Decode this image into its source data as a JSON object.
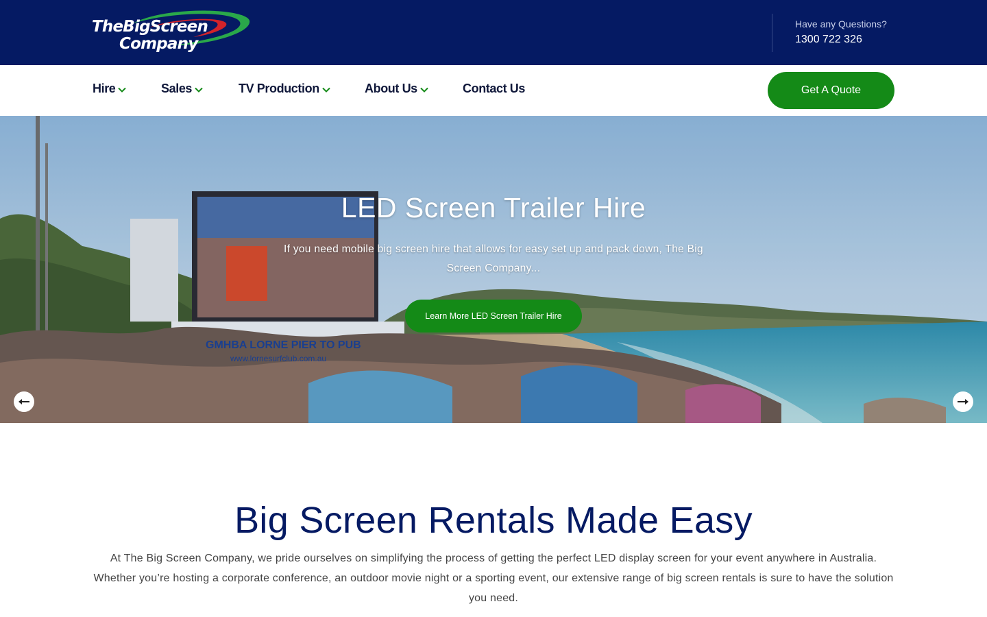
{
  "header": {
    "logo_line1": "TheBigScreen",
    "logo_line2": "Company",
    "questions_label": "Have any Questions?",
    "phone": "1300 722 326"
  },
  "nav": {
    "items": [
      {
        "label": "Hire",
        "has_dropdown": true
      },
      {
        "label": "Sales",
        "has_dropdown": true
      },
      {
        "label": "TV Production",
        "has_dropdown": true
      },
      {
        "label": "About Us",
        "has_dropdown": true
      },
      {
        "label": "Contact Us",
        "has_dropdown": false
      }
    ],
    "cta_label": "Get A Quote"
  },
  "hero": {
    "title": "LED Screen Trailer Hire",
    "subtitle": "If you need mobile big screen hire that allows for easy set up and pack down, The Big Screen Company...",
    "button_label": "Learn More LED Screen Trailer Hire",
    "screen_sign": "GMHBA  LORNE PIER TO PUB",
    "screen_url": "www.lornesurfclub.com.au",
    "prev_icon": "arrow-left-icon",
    "next_icon": "arrow-right-icon"
  },
  "intro": {
    "title": "Big Screen Rentals Made Easy",
    "text": "At The Big Screen Company, we pride ourselves on simplifying the process of getting the perfect LED display screen for your event anywhere in Australia. Whether you’re hosting a corporate conference, an outdoor movie night or a sporting event, our extensive range of big screen rentals is sure to have the solution you need."
  },
  "colors": {
    "brand_navy": "#051a63",
    "accent_green": "#148a17",
    "logo_red": "#d2232a",
    "logo_green": "#2aa84a"
  }
}
